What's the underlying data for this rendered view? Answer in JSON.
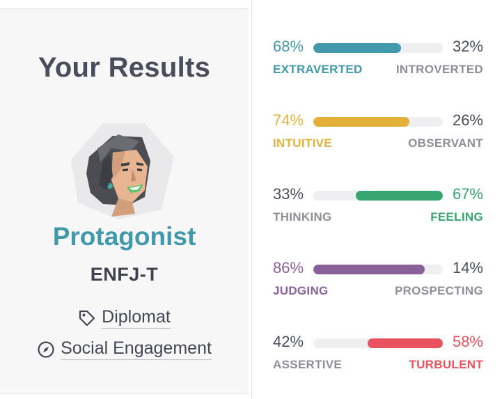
{
  "results": {
    "title": "Your Results",
    "type_name": "Protagonist",
    "type_code": "ENFJ-T",
    "role": "Diplomat",
    "strategy": "Social Engagement"
  },
  "colors": {
    "blue": "#4399ac",
    "yellow": "#e3b13a",
    "green": "#37a56f",
    "purple": "#8a609b",
    "red": "#e9525e",
    "gray_text": "#8d8e96",
    "dark_text": "#4a4e5c"
  },
  "traits": [
    {
      "left_pct": "68%",
      "right_pct": "32%",
      "left_label": "EXTRAVERTED",
      "right_label": "INTROVERTED",
      "dominant": "left",
      "fill_fraction": 0.68,
      "color": "#4399ac"
    },
    {
      "left_pct": "74%",
      "right_pct": "26%",
      "left_label": "INTUITIVE",
      "right_label": "OBSERVANT",
      "dominant": "left",
      "fill_fraction": 0.74,
      "color": "#e3b13a"
    },
    {
      "left_pct": "33%",
      "right_pct": "67%",
      "left_label": "THINKING",
      "right_label": "FEELING",
      "dominant": "right",
      "fill_fraction": 0.67,
      "color": "#37a56f"
    },
    {
      "left_pct": "86%",
      "right_pct": "14%",
      "left_label": "JUDGING",
      "right_label": "PROSPECTING",
      "dominant": "left",
      "fill_fraction": 0.86,
      "color": "#8a609b"
    },
    {
      "left_pct": "42%",
      "right_pct": "58%",
      "left_label": "ASSERTIVE",
      "right_label": "TURBULENT",
      "dominant": "right",
      "fill_fraction": 0.58,
      "color": "#e9525e"
    }
  ],
  "icons": {
    "role": "tag-icon",
    "strategy": "compass-icon",
    "avatar": "protagonist-avatar"
  }
}
